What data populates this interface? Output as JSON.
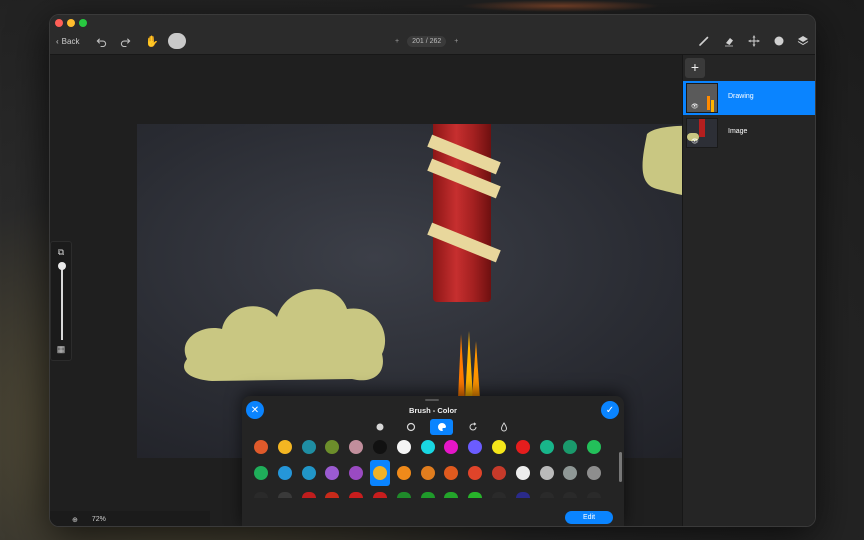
{
  "toolbar": {
    "back_label": "Back",
    "page_indicator": "201 / 262",
    "current_color": "#cfcfcf"
  },
  "zoom": {
    "label": "72%"
  },
  "layers": {
    "items": [
      {
        "name": "Drawing",
        "active": true
      },
      {
        "name": "Image",
        "active": false
      }
    ]
  },
  "brush_sheet": {
    "title": "Brush - Color",
    "modes": [
      "brush-dot-icon",
      "ring-icon",
      "palette-icon",
      "rotate-icon",
      "drop-icon"
    ],
    "selected_mode_index": 2,
    "palette_rows": [
      [
        "#e05a2b",
        "#f4b622",
        "#1f8ea3",
        "#6c8e2b",
        "#c18e9c",
        "#111111",
        "#f5f5f5",
        "#19d7e2",
        "#e516c8",
        "#6b5cff",
        "#f5e61a",
        "#e51d1d",
        "#18b58a",
        "#1a9a6c",
        "#23c05a"
      ],
      [
        "#1fae5a",
        "#2596d9",
        "#2196c8",
        "#9b5bd1",
        "#9a4ac2",
        "#f0b228",
        "#f08a1a",
        "#e07d1e",
        "#e05a1e",
        "#e0442a",
        "#c63a2a",
        "#ededed",
        "#bababa",
        "#8f9896",
        "#8e8e8e"
      ],
      [
        "#2a2a2a",
        "#3a3a3a",
        "#c01d1d",
        "#c82a1a",
        "#c81d1d",
        "#c81d1d",
        "#1f8a2a",
        "#1f9a2a",
        "#23a52a",
        "#27b32a",
        "#2a2a2a",
        "#2a2a8a",
        "#2a2a2a",
        "#2a2a2a",
        "#2a2a2a"
      ]
    ],
    "selected_swatch": {
      "row": 1,
      "col": 5
    },
    "edit_label": "Edit"
  }
}
